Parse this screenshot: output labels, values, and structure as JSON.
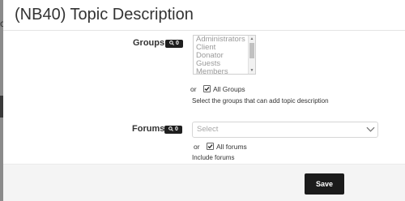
{
  "modal": {
    "title": "(NB40) Topic Description"
  },
  "backdrop": {
    "glyph": "c"
  },
  "groups": {
    "label": "Groups",
    "hint_count": "0",
    "options": [
      "Administrators",
      "Client",
      "Donator",
      "Guests",
      "Members"
    ],
    "or_text": "or",
    "all_label": "All Groups",
    "all_checked": true,
    "help": "Select the groups that can add topic description"
  },
  "forums": {
    "label": "Forums",
    "hint_count": "0",
    "placeholder": "Select",
    "or_text": "or",
    "all_label": "All forums",
    "all_checked": true,
    "help": "Include forums"
  },
  "footer": {
    "save_label": "Save"
  },
  "colors": {
    "primary_button": "#1b1b1b",
    "backdrop": "#8b8b8b"
  },
  "icons": {
    "hint": "search-icon",
    "check": "check-icon",
    "select_arrow": "chevron-down-icon"
  }
}
